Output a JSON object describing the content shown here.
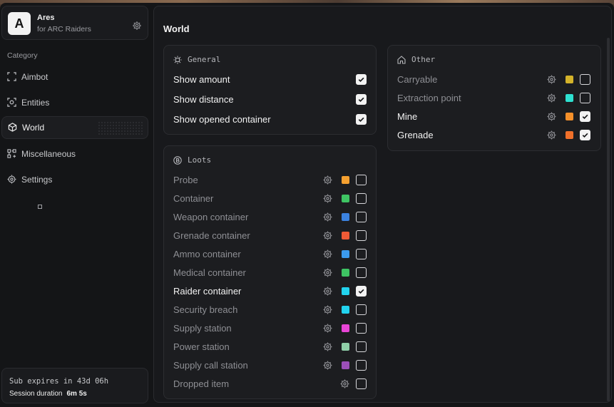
{
  "profile": {
    "avatar_letter": "A",
    "name": "Ares",
    "subtitle": "for ARC Raiders"
  },
  "sidebar": {
    "category_label": "Category",
    "items": [
      {
        "label": "Aimbot",
        "icon": "crosshair-square-icon"
      },
      {
        "label": "Entities",
        "icon": "target-icon"
      },
      {
        "label": "World",
        "icon": "cube-icon",
        "active": true
      },
      {
        "label": "Miscellaneous",
        "icon": "modules-icon"
      },
      {
        "label": "Settings",
        "icon": "gear-icon"
      }
    ]
  },
  "session": {
    "sub_expires": "Sub expires in 43d 06h",
    "duration_label": "Session duration",
    "duration_value": "6m 5s"
  },
  "main": {
    "title": "World",
    "general": {
      "title": "General",
      "rows": [
        {
          "label": "Show amount",
          "checked": true
        },
        {
          "label": "Show distance",
          "checked": true
        },
        {
          "label": "Show opened container",
          "checked": true
        }
      ]
    },
    "loots": {
      "title": "Loots",
      "rows": [
        {
          "label": "Probe",
          "color": "#f5a030",
          "checked": false
        },
        {
          "label": "Container",
          "color": "#3ec463",
          "checked": false
        },
        {
          "label": "Weapon container",
          "color": "#3b82e0",
          "checked": false
        },
        {
          "label": "Grenade container",
          "color": "#ee5a36",
          "checked": false
        },
        {
          "label": "Ammo container",
          "color": "#3b9aee",
          "checked": false
        },
        {
          "label": "Medical container",
          "color": "#3ec463",
          "checked": false
        },
        {
          "label": "Raider container",
          "color": "#22d3ee",
          "checked": true
        },
        {
          "label": "Security breach",
          "color": "#22d3ee",
          "checked": false
        },
        {
          "label": "Supply station",
          "color": "#e845d6",
          "checked": false
        },
        {
          "label": "Power station",
          "color": "#8fcfa8",
          "checked": false
        },
        {
          "label": "Supply call station",
          "color": "#9b4fb8",
          "checked": false
        },
        {
          "label": "Dropped item",
          "color": "",
          "checked": false
        }
      ]
    },
    "other": {
      "title": "Other",
      "rows": [
        {
          "label": "Carryable",
          "color": "#d4b32a",
          "checked": false
        },
        {
          "label": "Extraction point",
          "color": "#2ee0d0",
          "checked": false
        },
        {
          "label": "Mine",
          "color": "#f5902a",
          "checked": true
        },
        {
          "label": "Grenade",
          "color": "#f0702a",
          "checked": true
        }
      ]
    }
  }
}
